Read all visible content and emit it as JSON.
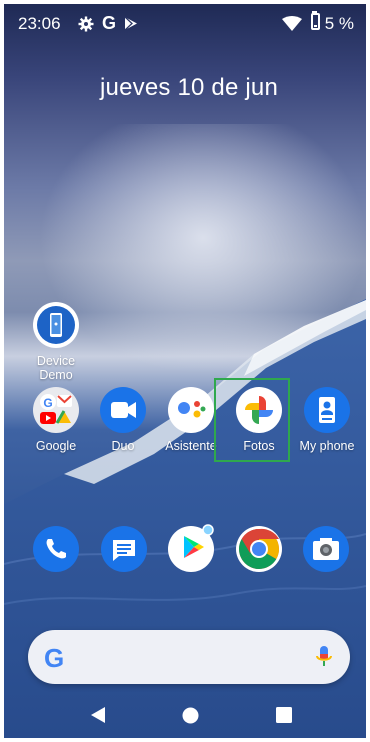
{
  "status_bar": {
    "time": "23:06",
    "battery": "5 %",
    "icons": [
      "settings-gear-icon",
      "google-g-icon",
      "play-store-icon",
      "wifi-icon",
      "battery-icon"
    ]
  },
  "date_widget": {
    "text": "jueves 10 de jun"
  },
  "home_apps": {
    "device_demo": {
      "label": "Device\nDemo",
      "line1": "Device",
      "line2": "Demo",
      "icon": "phone-demo-icon"
    },
    "row": [
      {
        "label": "Google",
        "icon": "google-folder-icon"
      },
      {
        "label": "Duo",
        "icon": "video-camera-icon"
      },
      {
        "label": "Asistente",
        "icon": "assistant-dots-icon"
      },
      {
        "label": "Fotos",
        "icon": "pinwheel-photos-icon"
      },
      {
        "label": "My phone",
        "icon": "contact-card-icon"
      }
    ]
  },
  "dock": [
    {
      "name": "phone",
      "icon": "phone-handset-icon"
    },
    {
      "name": "messages",
      "icon": "chat-bubble-icon"
    },
    {
      "name": "play store",
      "icon": "play-triangle-icon"
    },
    {
      "name": "chrome",
      "icon": "chrome-icon"
    },
    {
      "name": "camera",
      "icon": "camera-icon"
    }
  ],
  "search_bar": {
    "icon_left": "google-g-icon",
    "icon_right": "microphone-icon"
  },
  "nav_bar": {
    "back": "back-triangle-icon",
    "home": "home-circle-icon",
    "recents": "recents-square-icon"
  },
  "colors": {
    "highlight": "#2fa84d",
    "duo_blue": "#1a73e8",
    "sky_top": "#1f2a55"
  }
}
